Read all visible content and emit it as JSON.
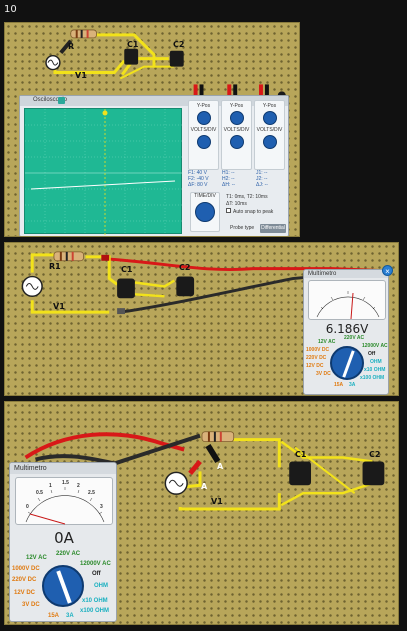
{
  "step_number": "10",
  "colors": {
    "board": "#b8a65a",
    "wire_yellow": "#f2e21a",
    "wire_red": "#d81818",
    "wire_black": "#2a2a2a",
    "scope_screen": "#1fb894",
    "meter_knob": "#1f5fb0"
  },
  "panel1": {
    "labels": {
      "r1": "R",
      "c1": "C1",
      "c2": "C2",
      "v1": "V1"
    },
    "scope": {
      "title": "Osciloscopio",
      "channels": [
        {
          "label": "Y-Pos",
          "volts": "VOLTS/DIV"
        },
        {
          "label": "Y-Pos",
          "volts": "VOLTS/DIV"
        },
        {
          "label": "Y-Pos",
          "volts": "VOLTS/DIV"
        }
      ],
      "readouts": [
        "F1: 40 V",
        "F2: -40 V",
        "ΔF: 80 V"
      ],
      "readouts_right": [
        "H1: --",
        "H2: --",
        "ΔH: --"
      ],
      "readouts_far": [
        "J1: --",
        "J2: --",
        "ΔJ: --"
      ],
      "timebase": "TIME/DIV",
      "time_info": [
        "T1: 0ms, T2: 10ms",
        "ΔT: 10ms"
      ],
      "auto_snap": "Auto snap to peak",
      "probe_type": "Probe type",
      "differential": "Differential"
    }
  },
  "panel2": {
    "labels": {
      "r1": "R1",
      "c1": "C1",
      "c2": "C2",
      "v1": "V1"
    },
    "meter": {
      "title": "Multímetro",
      "reading": "6.186V",
      "ranges": {
        "ac12": "12V AC",
        "ac220": "220V AC",
        "ac12000": "12000V AC",
        "dc1000": "1000V DC",
        "dc220": "220V DC",
        "dc12": "12V DC",
        "dc3": "3V DC",
        "off": "Off",
        "ohm": "OHM",
        "x10": "x10 OHM",
        "x100": "x100 OHM",
        "a15": "15A",
        "a3": "3A"
      }
    }
  },
  "panel3": {
    "labels": {
      "c1": "C1",
      "c2": "C2",
      "v1": "V1",
      "a1": "A",
      "a2": "A"
    },
    "meter": {
      "title": "Multimetro",
      "reading": "0A",
      "scale": [
        "0",
        "0.5",
        "1",
        "1.5",
        "2",
        "2.5",
        "3"
      ],
      "ranges": {
        "ac12": "12V AC",
        "ac220": "220V AC",
        "ac12000": "12000V AC",
        "dc1000": "1000V DC",
        "dc220": "220V DC",
        "dc12": "12V DC",
        "dc3": "3V DC",
        "off": "Off",
        "ohm": "OHM",
        "x10": "x10 OHM",
        "x100": "x100 OHM",
        "a15": "15A",
        "a3": "3A"
      }
    }
  }
}
